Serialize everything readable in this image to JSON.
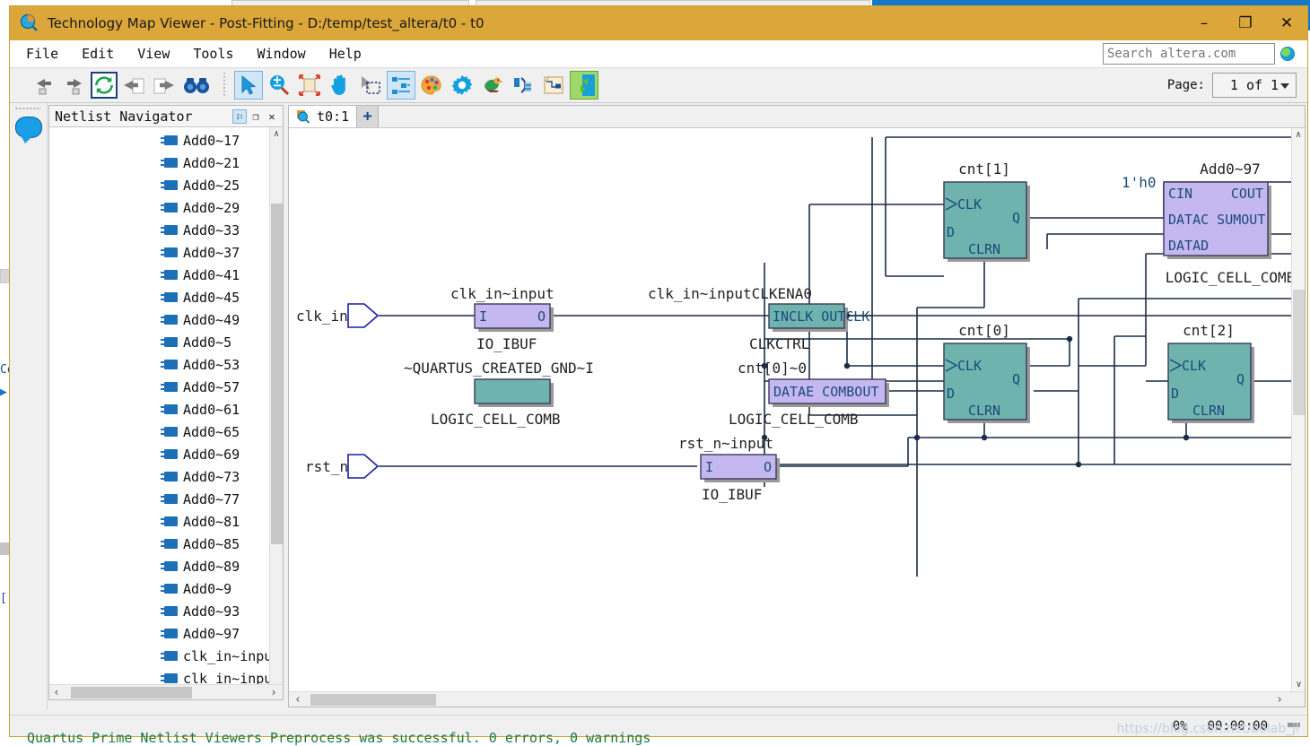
{
  "window": {
    "title": "Technology Map Viewer - Post-Fitting - D:/temp/test_altera/t0 - t0",
    "icon": "magnifier-chip-icon",
    "minimize": "–",
    "maximize": "❐",
    "close": "✕"
  },
  "menu": {
    "items": [
      "File",
      "Edit",
      "View",
      "Tools",
      "Window",
      "Help"
    ]
  },
  "search": {
    "placeholder": "Search altera.com",
    "value": "",
    "globe_icon": "globe-icon"
  },
  "toolbar": {
    "buttons": [
      {
        "name": "back-to-parent-icon",
        "glyph": "arrow-left-stack"
      },
      {
        "name": "forward-to-child-icon",
        "glyph": "arrow-right-stack"
      },
      {
        "name": "refresh-icon",
        "glyph": "refresh-circle"
      },
      {
        "name": "previous-page-icon",
        "glyph": "arrow-left-page"
      },
      {
        "name": "next-page-icon",
        "glyph": "arrow-right-page"
      },
      {
        "name": "find-icon",
        "glyph": "binoculars"
      },
      {
        "name": "select-tool-icon",
        "glyph": "cursor-arrow"
      },
      {
        "name": "zoom-tool-icon",
        "glyph": "magnifier-plus-minus"
      },
      {
        "name": "fit-in-window-icon",
        "glyph": "fit-arrows"
      },
      {
        "name": "hand-pan-icon",
        "glyph": "open-hand"
      },
      {
        "name": "area-select-icon",
        "glyph": "cursor-marquee"
      },
      {
        "name": "hierarchy-tree-icon",
        "glyph": "tree-nodes"
      },
      {
        "name": "color-settings-icon",
        "glyph": "palette"
      },
      {
        "name": "settings-icon",
        "glyph": "gear"
      },
      {
        "name": "chip-planner-icon",
        "glyph": "parrot"
      },
      {
        "name": "bus-tools-icon",
        "glyph": "bus-split"
      },
      {
        "name": "schematic-report-icon",
        "glyph": "page-schematic"
      },
      {
        "name": "expand-collapse-icon",
        "glyph": "green-arrows"
      }
    ]
  },
  "page": {
    "label": "Page:",
    "value": "1 of 1"
  },
  "navigator": {
    "title": "Netlist Navigator",
    "controls": [
      {
        "name": "pin-panel-button",
        "glyph": "⚐"
      },
      {
        "name": "float-panel-button",
        "glyph": "❐"
      },
      {
        "name": "close-panel-button",
        "glyph": "✕"
      }
    ],
    "items": [
      "Add0~17",
      "Add0~21",
      "Add0~25",
      "Add0~29",
      "Add0~33",
      "Add0~37",
      "Add0~41",
      "Add0~45",
      "Add0~49",
      "Add0~5",
      "Add0~53",
      "Add0~57",
      "Add0~61",
      "Add0~65",
      "Add0~69",
      "Add0~73",
      "Add0~77",
      "Add0~81",
      "Add0~85",
      "Add0~89",
      "Add0~9",
      "Add0~93",
      "Add0~97",
      "clk_in~input",
      "clk_in~inputC"
    ],
    "scroll_left": "‹",
    "scroll_right": "›",
    "scroll_up": "∧",
    "scroll_down": "∨"
  },
  "tabs": {
    "active": "t0:1",
    "add_label": "+"
  },
  "canvas": {
    "scroll_left": "‹",
    "scroll_right": "›",
    "scroll_up": "∧",
    "scroll_down": "∨"
  },
  "schematic": {
    "colors": {
      "block_teal": "#6fb3ae",
      "block_purple": "#c5b8f0",
      "block_border": "#3a3a5a",
      "wire": "#1a2c46",
      "port_text": "#1b4a7a",
      "label_text": "#262626",
      "shadow": "#9a9a9a",
      "pin_outline": "#1a1aa8"
    },
    "ports": [
      {
        "name": "clk_in",
        "label": "clk_in"
      },
      {
        "name": "rst_n",
        "label": "rst_n"
      }
    ],
    "constants": [
      {
        "name": "cin-constant",
        "label": "1'h0"
      }
    ],
    "blocks": [
      {
        "id": "clk_in_input",
        "title": "clk_in~input",
        "subtitle": "IO_IBUF",
        "fill": "purple",
        "pins_left": [
          "I"
        ],
        "pins_right": [
          "O"
        ]
      },
      {
        "id": "quartus_created_gnd",
        "title": "~QUARTUS_CREATED_GND~I",
        "subtitle": "LOGIC_CELL_COMB",
        "fill": "teal",
        "pins_left": [],
        "pins_right": []
      },
      {
        "id": "clk_in_inputCLKENA0",
        "title": "clk_in~inputCLKENA0",
        "subtitle": "CLKCTRL",
        "fill": "teal",
        "pins_left": [
          "INCLK"
        ],
        "pins_right": [
          "OUTCLK"
        ]
      },
      {
        "id": "cnt0_0",
        "title": "cnt[0]~0",
        "subtitle": "LOGIC_CELL_COMB",
        "fill": "purple",
        "pins_left": [
          "DATAE"
        ],
        "pins_right": [
          "COMBOUT"
        ]
      },
      {
        "id": "rst_n_input",
        "title": "rst_n~input",
        "subtitle": "IO_IBUF",
        "fill": "purple",
        "pins_left": [
          "I"
        ],
        "pins_right": [
          "O"
        ]
      },
      {
        "id": "cnt1",
        "title": "cnt[1]",
        "subtitle": "",
        "fill": "teal",
        "pins_left": [
          "CLK",
          "D"
        ],
        "pins_right": [
          "Q"
        ],
        "pins_bottom": [
          "CLRN"
        ]
      },
      {
        "id": "cnt0",
        "title": "cnt[0]",
        "subtitle": "",
        "fill": "teal",
        "pins_left": [
          "CLK",
          "D"
        ],
        "pins_right": [
          "Q"
        ],
        "pins_bottom": [
          "CLRN"
        ]
      },
      {
        "id": "cnt2",
        "title": "cnt[2]",
        "subtitle": "",
        "fill": "teal",
        "pins_left": [
          "CLK",
          "D"
        ],
        "pins_right": [
          "Q"
        ],
        "pins_bottom": [
          "CLRN"
        ]
      },
      {
        "id": "add0_97",
        "title": "Add0~97",
        "subtitle": "LOGIC_CELL_COMB",
        "fill": "purple",
        "pins_left": [
          "CIN",
          "DATAC",
          "DATAD"
        ],
        "pins_right": [
          "COUT",
          "SUMOUT"
        ]
      }
    ]
  },
  "status": {
    "zoom": "0%",
    "time": "00:00:00",
    "grip": "resize-grip-icon"
  },
  "console": {
    "message": "Quartus Prime Netlist Viewers Preprocess was successful. 0 errors, 0 warnings"
  },
  "watermark": {
    "text": "https://blog.csdn.net/bolab_jl"
  }
}
